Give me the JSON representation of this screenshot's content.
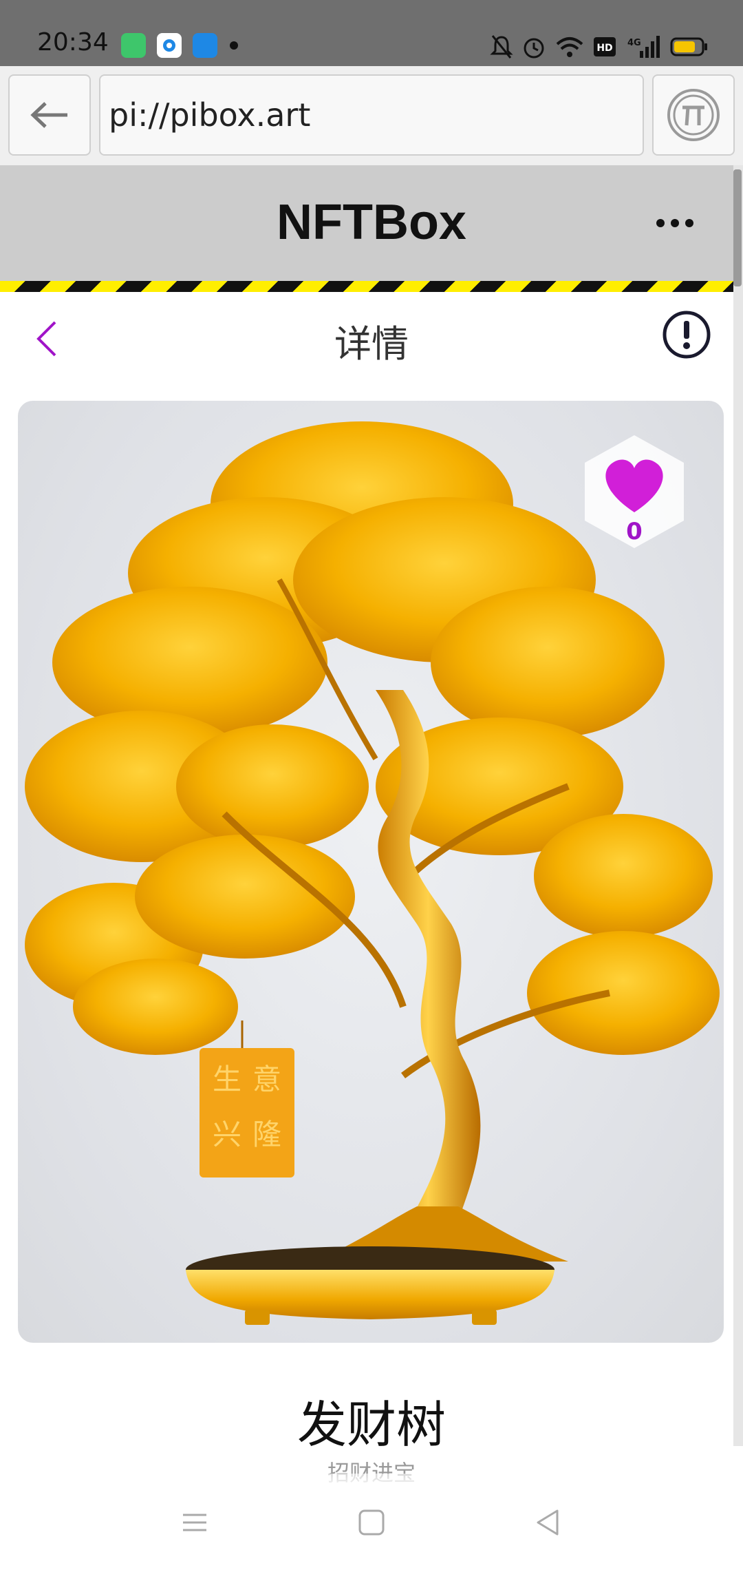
{
  "status_bar": {
    "time": "20:34"
  },
  "browser": {
    "url": "pi://pibox.art"
  },
  "app": {
    "title": "NFTBox"
  },
  "detail": {
    "header_title": "详情",
    "like_count": "0",
    "nft_name": "发财树",
    "nft_subtitle": "招财进宝",
    "tag_text": [
      "生",
      "意",
      "兴",
      "隆"
    ]
  },
  "colors": {
    "accent": "#a014c8",
    "heart": "#d11fd8",
    "gold": "#f5b400",
    "header_bg": "#cccccc"
  },
  "icons": [
    "back-arrow-icon",
    "pi-logo-icon",
    "more-icon",
    "chevron-left-icon",
    "info-icon",
    "heart-icon",
    "menu-icon",
    "home-icon",
    "back-triangle-icon"
  ]
}
